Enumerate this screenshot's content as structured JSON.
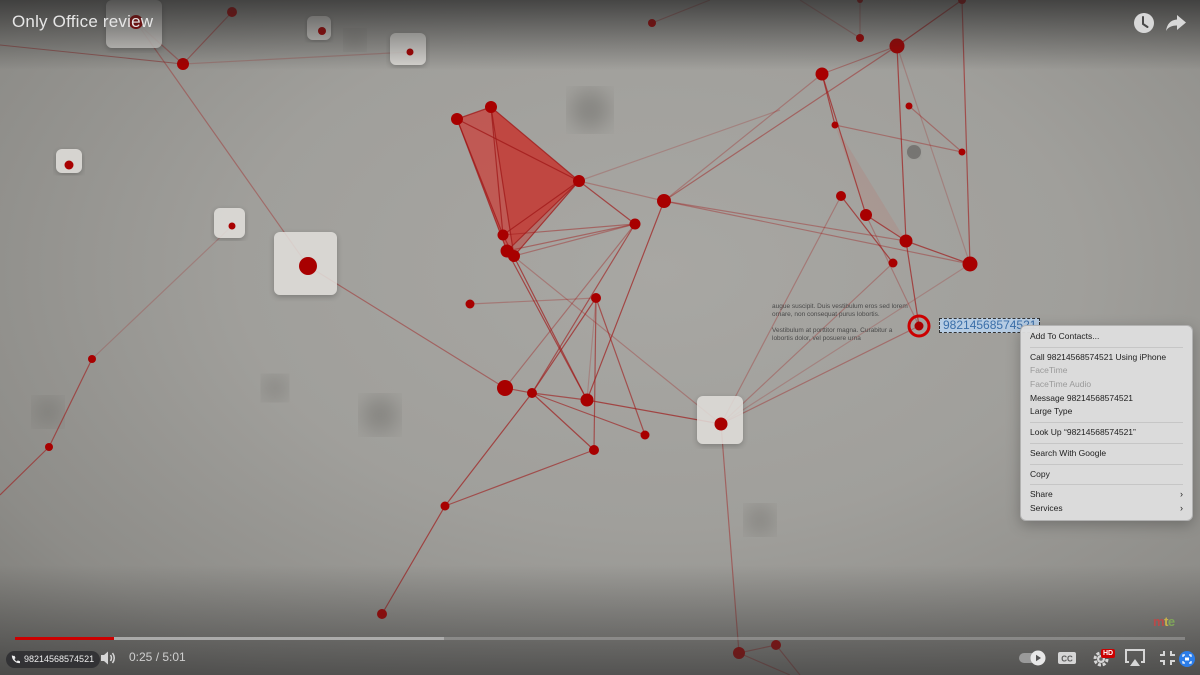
{
  "video": {
    "title": "Only Office review",
    "current_time": "0:25",
    "duration": "5:01",
    "time_display": "0:25 / 5:01",
    "played_fraction": 0.085,
    "buffered_fraction": 0.367,
    "hd_badge": "HD",
    "watermark": [
      "m",
      "t",
      "e"
    ]
  },
  "colors": {
    "accent_red": "#cc0000",
    "node_red": "#a80000",
    "selection_blue": "#b6cce3",
    "focus_blue": "#2b7de9"
  },
  "top_icons": [
    {
      "name": "watch-later-icon",
      "label": "Watch later"
    },
    {
      "name": "share-icon",
      "label": "Share"
    }
  ],
  "overlay_text": {
    "lorem_lines_1": "augue suscipit. Duis vestibulum eros sed lorem ornare, non consequat purus lobortis.",
    "lorem_lines_2": "Vestibulum at porttitor magna. Curabitur a lobortis dolor, vel posuere urna",
    "selected_number": "98214568574521"
  },
  "context_menu": {
    "items": [
      {
        "label": "Add To Contacts...",
        "enabled": true
      },
      {
        "separator": true
      },
      {
        "label": "Call 98214568574521 Using iPhone",
        "enabled": true
      },
      {
        "label": "FaceTime",
        "enabled": false
      },
      {
        "label": "FaceTime Audio",
        "enabled": false
      },
      {
        "label": "Message 98214568574521",
        "enabled": true
      },
      {
        "label": "Large Type",
        "enabled": true
      },
      {
        "separator": true
      },
      {
        "label": "Look Up “98214568574521”",
        "enabled": true
      },
      {
        "separator": true
      },
      {
        "label": "Search With Google",
        "enabled": true
      },
      {
        "separator": true
      },
      {
        "label": "Copy",
        "enabled": true
      },
      {
        "separator": true
      },
      {
        "label": "Share",
        "enabled": true,
        "submenu": true
      },
      {
        "label": "Services",
        "enabled": true,
        "submenu": true
      }
    ],
    "submenu_glyph": "›"
  },
  "controls": {
    "phone_chip_number": "98214568574521",
    "buttons": [
      "volume",
      "autoplay-toggle",
      "captions",
      "settings",
      "airplay",
      "exit-fullscreen",
      "screen-capture"
    ]
  }
}
